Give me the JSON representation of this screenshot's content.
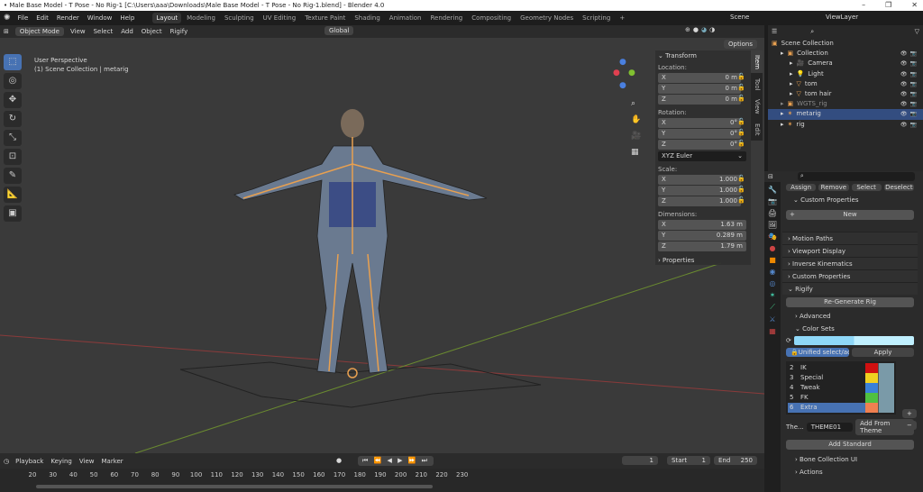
{
  "window": {
    "title": "• Male Base Model - T Pose - No Rig-1 [C:\\Users\\aaa\\Downloads\\Male Base Model - T Pose - No Rig-1.blend] - Blender 4.0"
  },
  "menu": [
    "File",
    "Edit",
    "Render",
    "Window",
    "Help"
  ],
  "workspaces": [
    "Layout",
    "Modeling",
    "Sculpting",
    "UV Editing",
    "Texture Paint",
    "Shading",
    "Animation",
    "Rendering",
    "Compositing",
    "Geometry Nodes",
    "Scripting",
    "+"
  ],
  "scene": {
    "scene": "Scene",
    "view_layer": "ViewLayer"
  },
  "viewport_header": {
    "mode": "Object Mode",
    "menus": [
      "View",
      "Select",
      "Add",
      "Object",
      "Rigify"
    ],
    "orientation": "Global",
    "options": "Options"
  },
  "viewport": {
    "perspective": "User Perspective",
    "context": "(1) Scene Collection | metarig"
  },
  "npanel": {
    "tabs": [
      "Item",
      "Tool",
      "View",
      "Edit"
    ],
    "transform": "Transform",
    "location_label": "Location:",
    "location": [
      [
        "X",
        "0 m"
      ],
      [
        "Y",
        "0 m"
      ],
      [
        "Z",
        "0 m"
      ]
    ],
    "rotation_label": "Rotation:",
    "rotation": [
      [
        "X",
        "0°"
      ],
      [
        "Y",
        "0°"
      ],
      [
        "Z",
        "0°"
      ]
    ],
    "rotation_mode": "XYZ Euler",
    "scale_label": "Scale:",
    "scale": [
      [
        "X",
        "1.000"
      ],
      [
        "Y",
        "1.000"
      ],
      [
        "Z",
        "1.000"
      ]
    ],
    "dimensions_label": "Dimensions:",
    "dimensions": [
      [
        "X",
        "1.63 m"
      ],
      [
        "Y",
        "0.289 m"
      ],
      [
        "Z",
        "1.79 m"
      ]
    ],
    "properties": "Properties"
  },
  "outliner": {
    "items": [
      {
        "label": "Scene Collection",
        "indent": 0
      },
      {
        "label": "Collection",
        "indent": 1
      },
      {
        "label": "Camera",
        "indent": 2
      },
      {
        "label": "Light",
        "indent": 2
      },
      {
        "label": "tom",
        "indent": 2
      },
      {
        "label": "tom hair",
        "indent": 2
      },
      {
        "label": "WGTS_rig",
        "indent": 1
      },
      {
        "label": "metarig",
        "indent": 1,
        "selected": true
      },
      {
        "label": "rig",
        "indent": 1
      }
    ]
  },
  "properties": {
    "buttons": [
      "Assign",
      "Remove",
      "Select",
      "Deselect"
    ],
    "custom_properties": "Custom Properties",
    "new": "New",
    "sections": [
      "Motion Paths",
      "Viewport Display",
      "Inverse Kinematics",
      "Custom Properties",
      "Rigify"
    ],
    "regenerate": "Re-Generate Rig",
    "advanced": "Advanced",
    "color_sets": "Color Sets",
    "unified": "Unified select/act...",
    "apply": "Apply",
    "color_list": [
      {
        "n": "2",
        "name": "IK",
        "color": "#d01010"
      },
      {
        "n": "3",
        "name": "Special",
        "color": "#f0d020"
      },
      {
        "n": "4",
        "name": "Tweak",
        "color": "#3a80d8"
      },
      {
        "n": "5",
        "name": "FK",
        "color": "#50c040"
      },
      {
        "n": "6",
        "name": "Extra",
        "color": "#f08050",
        "selected": true
      }
    ],
    "theme_label": "The...",
    "theme": "THEME01",
    "add_from_theme": "Add From Theme",
    "add_standard": "Add Standard",
    "bone_collection_ui": "Bone Collection UI",
    "actions": "Actions"
  },
  "timeline": {
    "menus": [
      "Playback",
      "Keying",
      "View",
      "Marker"
    ],
    "current_frame": "1",
    "start_label": "Start",
    "start": "1",
    "end_label": "End",
    "end": "250",
    "ticks": [
      "20",
      "30",
      "40",
      "50",
      "60",
      "70",
      "80",
      "90",
      "100",
      "110",
      "120",
      "130",
      "140",
      "150",
      "160",
      "170",
      "180",
      "190",
      "200",
      "210",
      "220",
      "230"
    ]
  },
  "colors": {
    "accent": "#4772b3",
    "bone": "#e8a050",
    "selection": "#334d80"
  }
}
